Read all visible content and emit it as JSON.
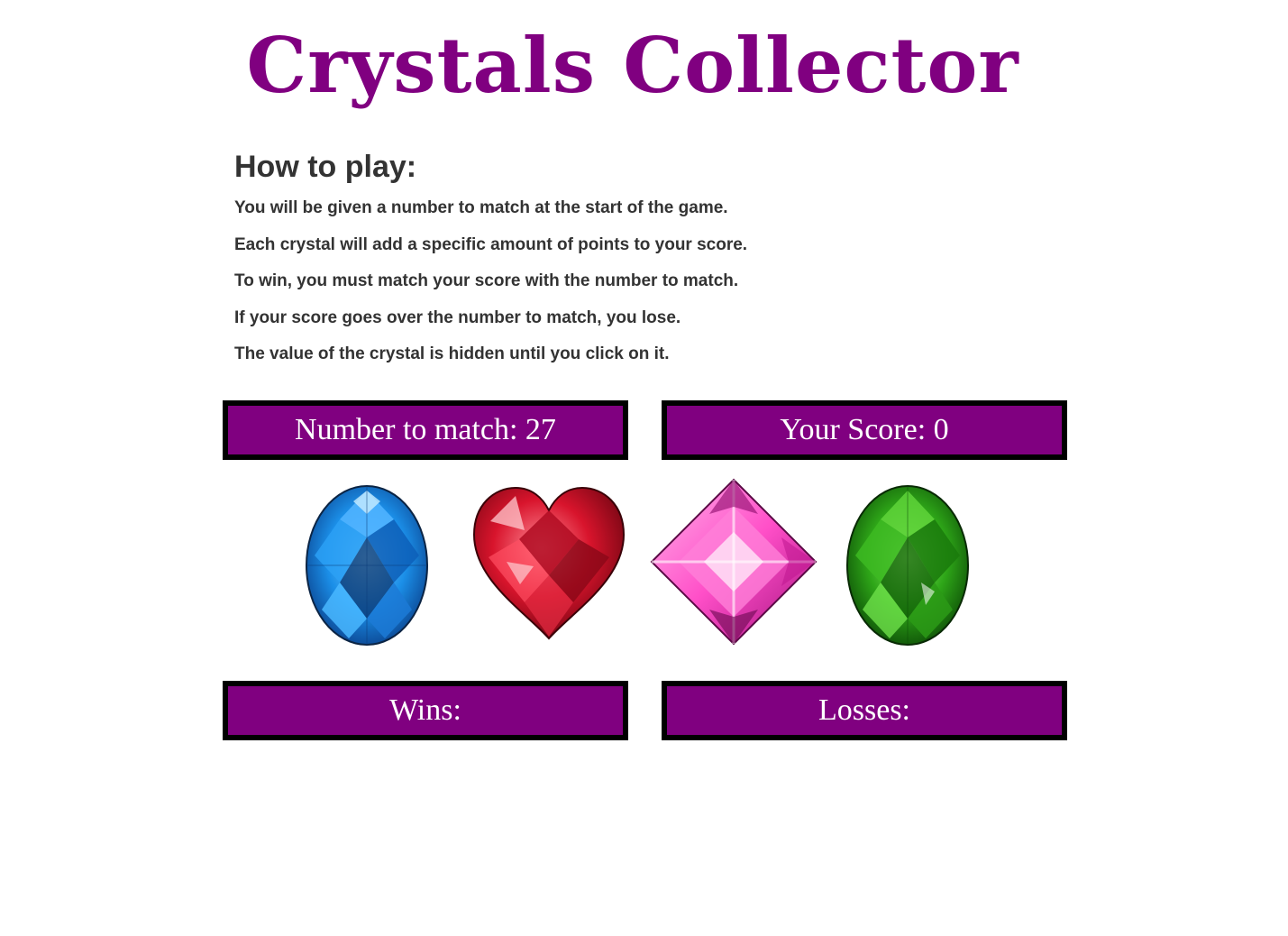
{
  "title": "Crystals Collector",
  "instructions": {
    "heading": "How to play:",
    "rules": [
      "You will be given a number to match at the start of the game.",
      "Each crystal will add a specific amount of points to your score.",
      "To win, you must match your score with the number to match.",
      "If your score goes over the number to match, you lose.",
      "The value of the crystal is hidden until you click on it."
    ]
  },
  "scoreboard": {
    "target_text": "Number to match: 27",
    "score_text": "Your Score: 0",
    "wins_text": "Wins:",
    "losses_text": "Losses:"
  },
  "crystals": [
    {
      "name": "blue-crystal",
      "shape": "oval",
      "color": "#1e90ff"
    },
    {
      "name": "red-crystal",
      "shape": "heart",
      "color": "#d0102a"
    },
    {
      "name": "pink-crystal",
      "shape": "diamond",
      "color": "#ff4fc8"
    },
    {
      "name": "green-crystal",
      "shape": "oval",
      "color": "#1f9e12"
    }
  ],
  "colors": {
    "accent": "#800080",
    "border": "#000000",
    "text": "#333333"
  }
}
